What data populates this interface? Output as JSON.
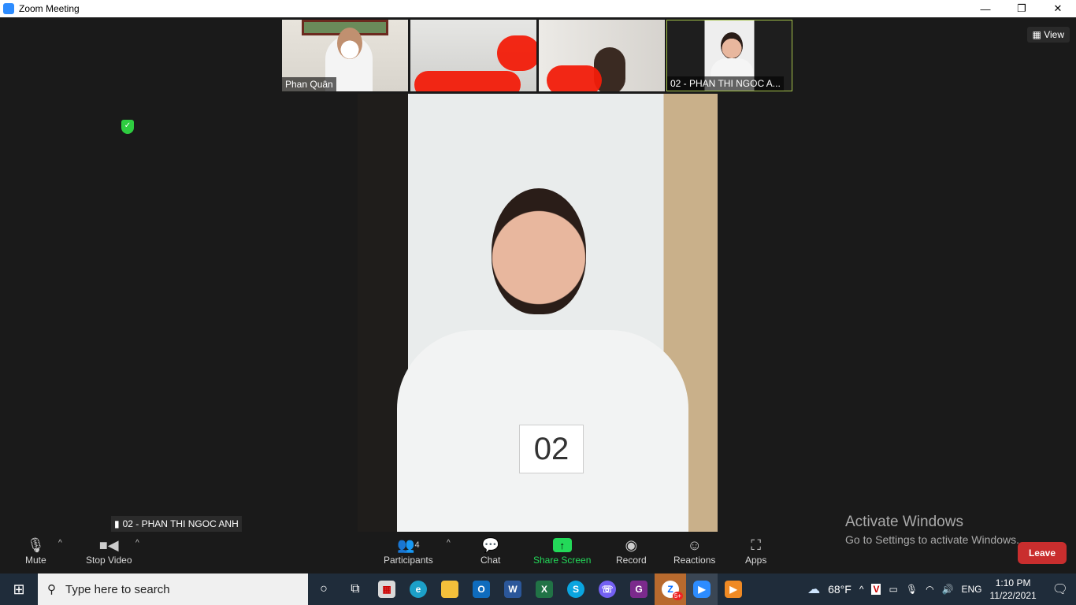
{
  "window": {
    "title": "Zoom Meeting",
    "controls": [
      "minimize",
      "restore",
      "close"
    ]
  },
  "view_button": "View",
  "thumbnails": [
    {
      "name": "Phan Quân",
      "redacted": false
    },
    {
      "name": "",
      "redacted": true
    },
    {
      "name": "",
      "redacted": true
    },
    {
      "name": "02 - PHAN THI NGOC A...",
      "active": true
    }
  ],
  "main_video": {
    "speaker": "02 - PHAN THI NGOC ANH",
    "badge_text": "02"
  },
  "activation": {
    "title": "Activate Windows",
    "subtitle": "Go to Settings to activate Windows."
  },
  "toolbar": {
    "mute": "Mute",
    "stop_video": "Stop Video",
    "participants": "Participants",
    "participants_count": "4",
    "chat": "Chat",
    "share_screen": "Share Screen",
    "record": "Record",
    "reactions": "Reactions",
    "apps": "Apps",
    "leave": "Leave"
  },
  "taskbar": {
    "search_placeholder": "Type here to search",
    "weather": "68°F",
    "language": "ENG",
    "time": "1:10 PM",
    "date": "11/22/2021",
    "zalo_badge": "5+"
  },
  "colors": {
    "accent_green": "#23d959",
    "leave_red": "#c92e2e",
    "zoom_blue": "#2d8cff"
  }
}
